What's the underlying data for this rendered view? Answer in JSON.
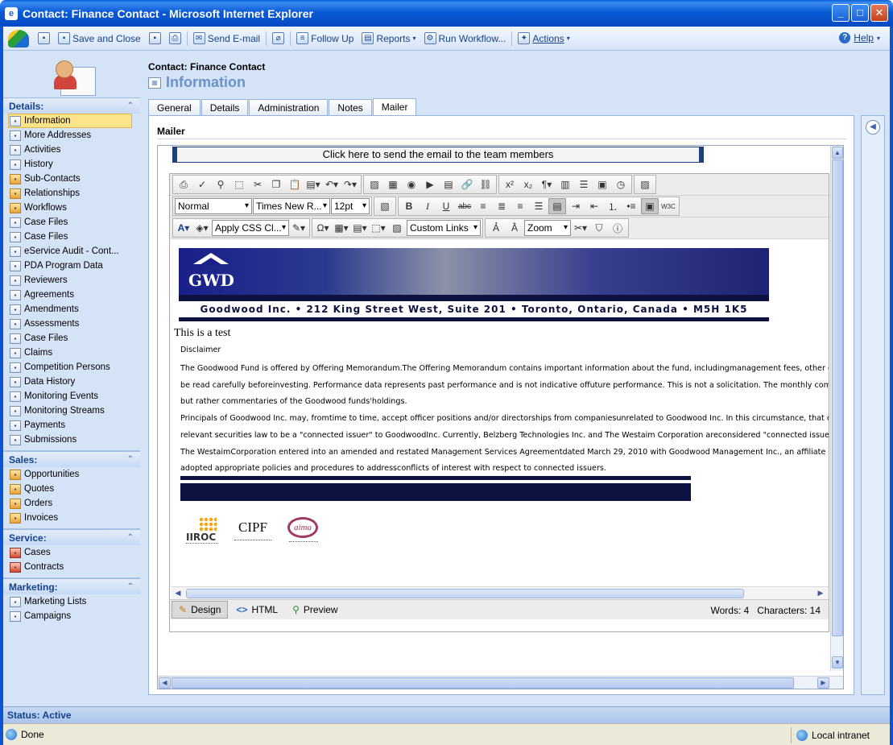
{
  "window": {
    "title": "Contact: Finance Contact - Microsoft Internet Explorer",
    "minimize": "_",
    "maximize": "□",
    "close": "✕"
  },
  "toolbar": {
    "save_and_close": "Save and Close",
    "send_email": "Send E-mail",
    "follow_up": "Follow Up",
    "reports": "Reports",
    "run_workflow": "Run Workflow...",
    "actions": "Actions",
    "help": "Help"
  },
  "form": {
    "entity": "Contact: Finance Contact",
    "title": "Information"
  },
  "nav": {
    "details": {
      "header": "Details:",
      "items": [
        "Information",
        "More Addresses",
        "Activities",
        "History",
        "Sub-Contacts",
        "Relationships",
        "Workflows",
        "Case Files",
        "Case Files",
        "eService Audit - Cont...",
        "PDA Program Data",
        "Reviewers",
        "Agreements",
        "Amendments",
        "Assessments",
        "Case Files",
        "Claims",
        "Competition Persons",
        "Data History",
        "Monitoring Events",
        "Monitoring Streams",
        "Payments",
        "Submissions"
      ]
    },
    "sales": {
      "header": "Sales:",
      "items": [
        "Opportunities",
        "Quotes",
        "Orders",
        "Invoices"
      ]
    },
    "service": {
      "header": "Service:",
      "items": [
        "Cases",
        "Contracts"
      ]
    },
    "marketing": {
      "header": "Marketing:",
      "items": [
        "Marketing Lists",
        "Campaigns"
      ]
    }
  },
  "tabs": [
    "General",
    "Details",
    "Administration",
    "Notes",
    "Mailer"
  ],
  "active_tab": "Mailer",
  "section": {
    "title": "Mailer",
    "send_button": "Click here to send the email to the team members"
  },
  "editor": {
    "format": "Normal",
    "font": "Times New R...",
    "size": "12pt",
    "css_class": "Apply CSS Cl...",
    "custom_links": "Custom Links",
    "zoom": "Zoom",
    "modes": [
      "Design",
      "HTML",
      "Preview"
    ],
    "words": "Words: 4",
    "characters": "Characters: 14"
  },
  "content": {
    "banner_logo": "GWD",
    "banner_address": "Goodwood Inc. • 212 King Street West, Suite 201 • Toronto, Ontario, Canada  •  M5H 1K5",
    "test_line": "This is a test",
    "disclaimer_head": "Disclaimer",
    "disclaimer_lines": [
      "The Goodwood Fund is offered by Offering Memorandum.The Offering Memorandum contains important information about the fund, includingmanagement fees, other charges and",
      "be read carefully beforeinvesting. Performance data represents past performance and is not indicative offuture performance. This is not a solicitation. The monthly commentaries are",
      "but rather commentaries of the Goodwood funds'holdings.",
      "Principals of Goodwood Inc. may, fromtime to time, accept officer positions and/or directorships from companiesunrelated to Goodwood Inc. In this circumstance, that company wo",
      "relevant securities law to be a \"connected issuer\" to GoodwoodInc. Currently, Belzberg Technologies Inc. and The Westaim Corporation areconsidered \"connected issuers\" in respe",
      "The WestaimCorporation entered into an amended and restated Management Services Agreementdated March 29, 2010 with Goodwood Management Inc., an affiliate of Goodwood",
      "adopted appropriate policies and procedures to addressconflicts of interest with respect to connected issuers."
    ],
    "logo_iiroc": "IIROC",
    "logo_cipf": "CIPF",
    "logo_aima": "aima"
  },
  "status": {
    "record": "Status: Active",
    "browser": "Done",
    "zone": "Local intranet"
  }
}
